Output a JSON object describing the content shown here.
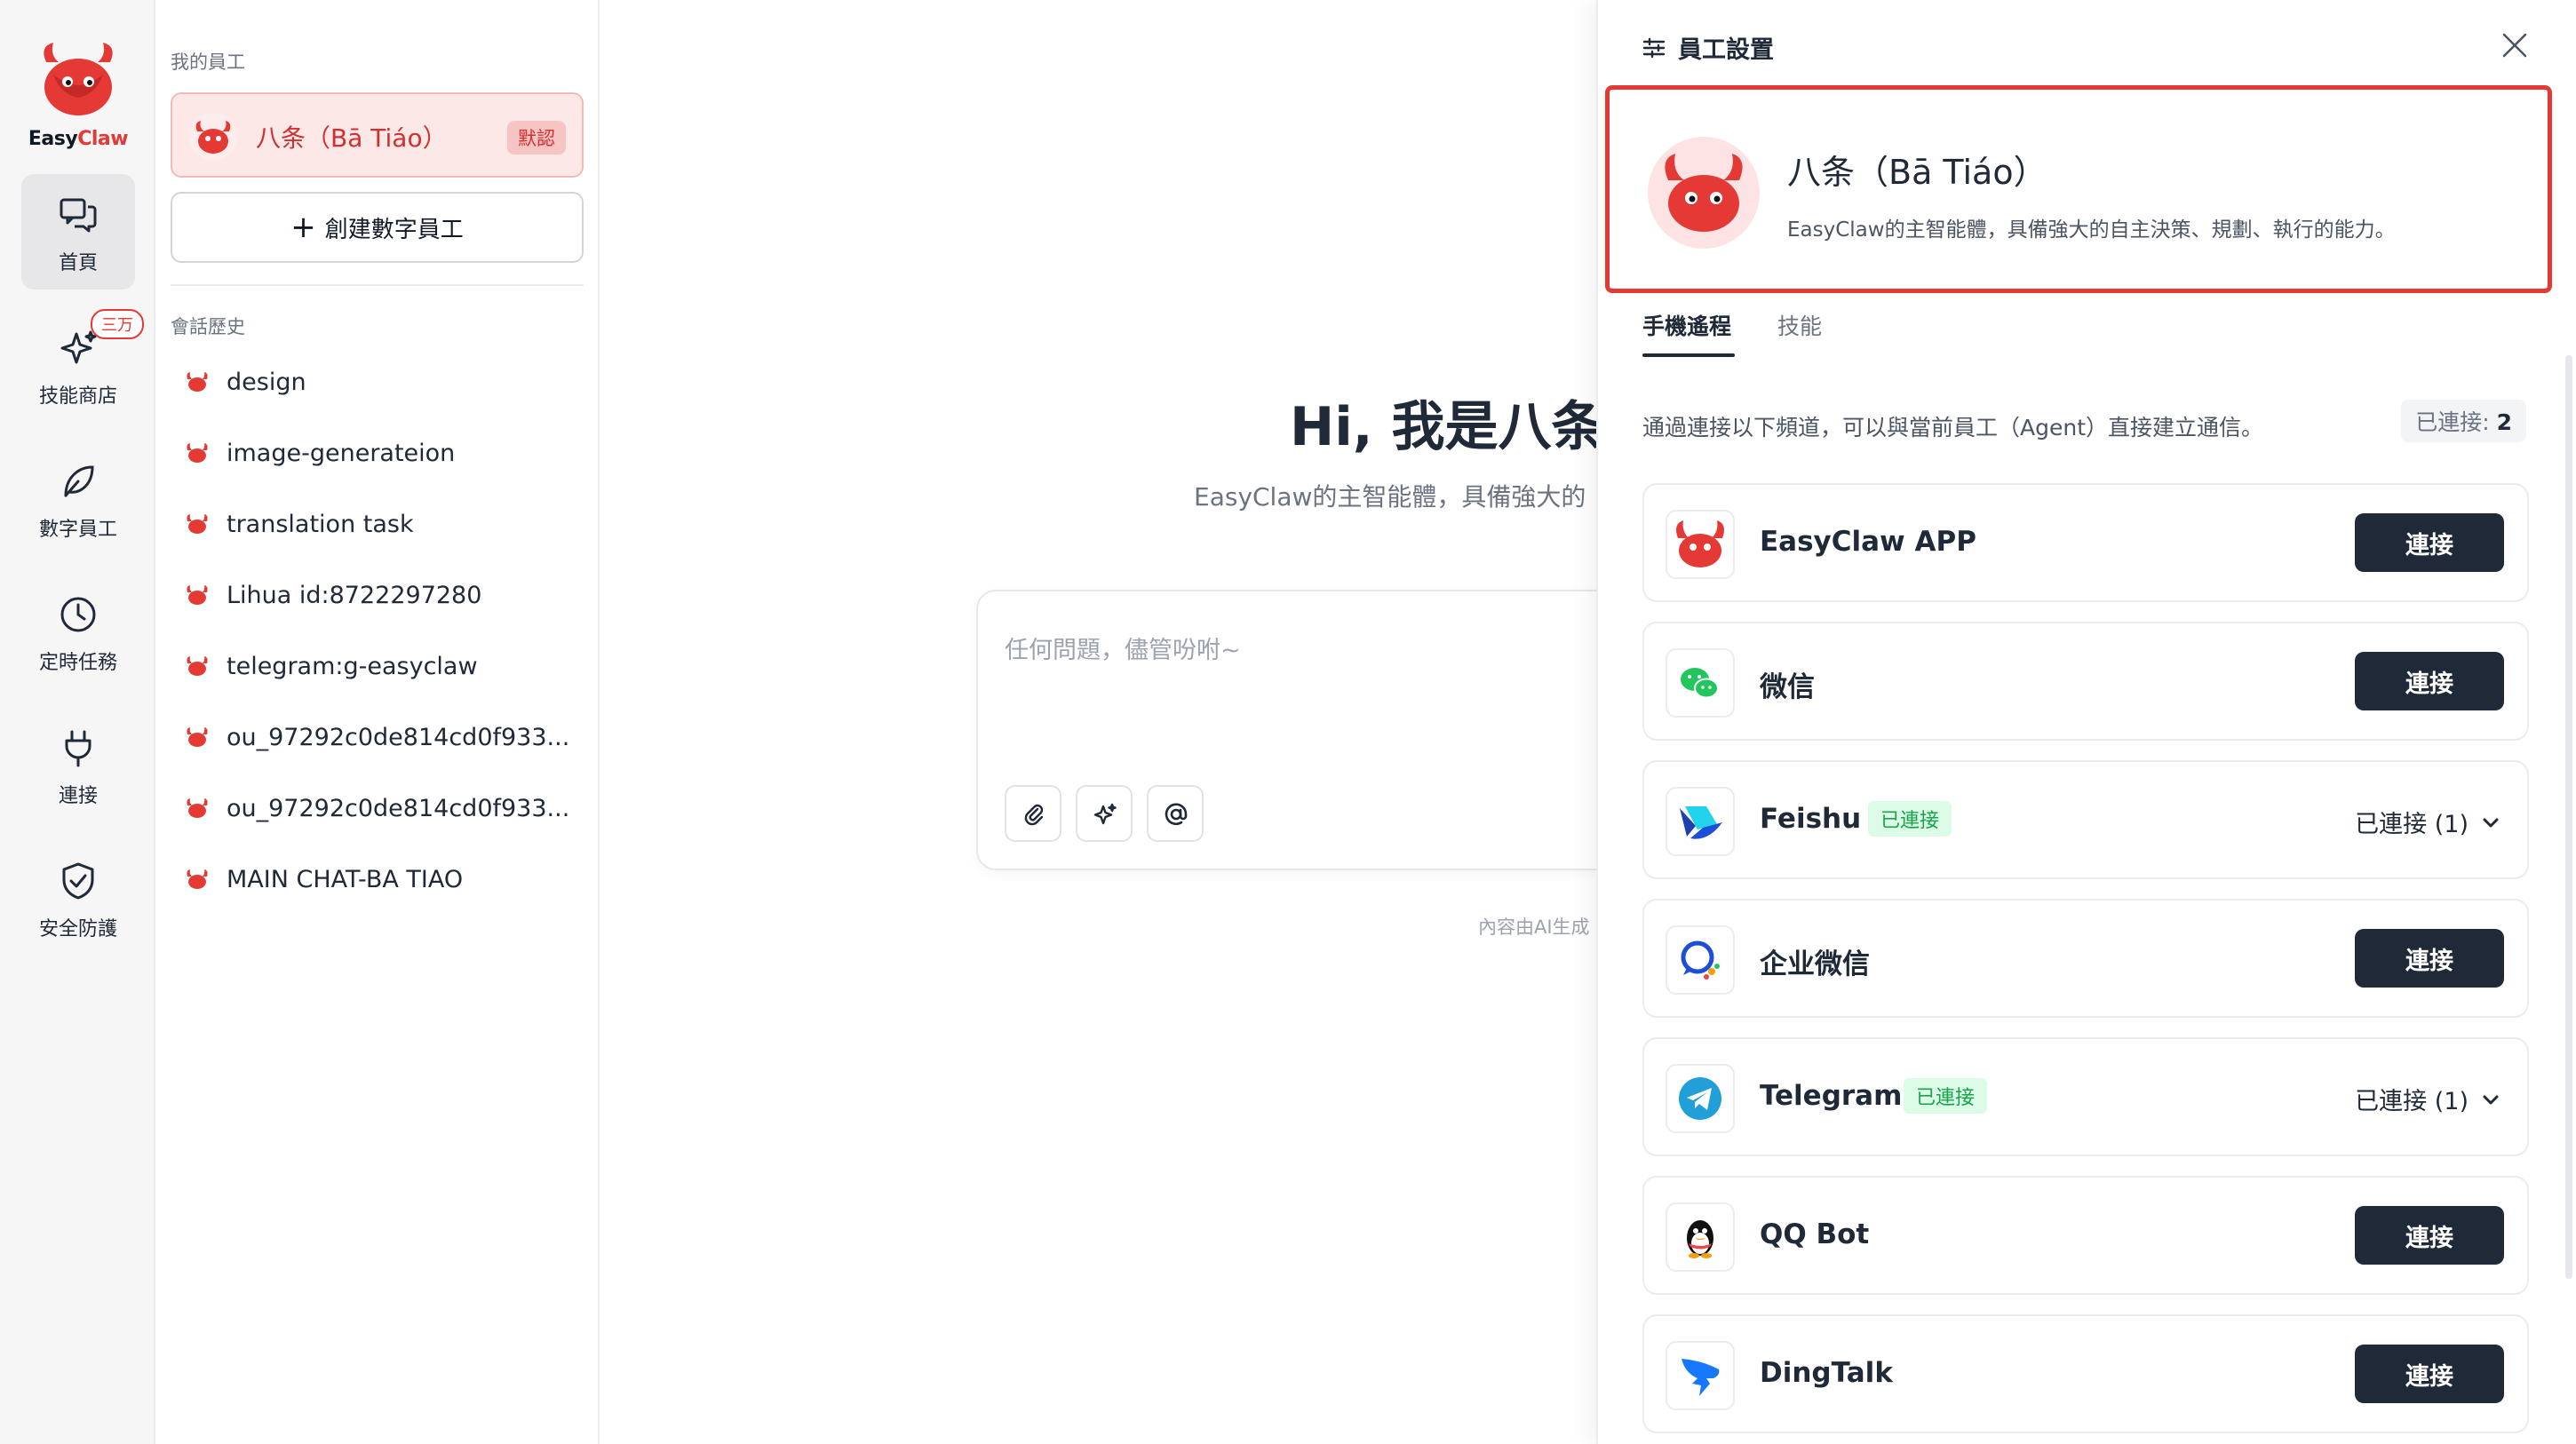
{
  "brand": {
    "logo_text_a": "Easy",
    "logo_text_b": "Claw"
  },
  "nav": {
    "items": [
      {
        "label": "首頁",
        "icon": "chat-bubbles-icon"
      },
      {
        "label": "技能商店",
        "icon": "sparkle-icon",
        "badge": "三万"
      },
      {
        "label": "數字員工",
        "icon": "leaf-icon"
      },
      {
        "label": "定時任務",
        "icon": "clock-icon"
      },
      {
        "label": "連接",
        "icon": "plug-icon"
      },
      {
        "label": "安全防護",
        "icon": "shield-icon"
      }
    ]
  },
  "sidebar": {
    "my_employees_label": "我的員工",
    "employee": {
      "name": "八条（Bā Tiáo）",
      "tag": "默認"
    },
    "create_label": "創建數字員工",
    "history_label": "會話歷史",
    "history": [
      "design",
      "image-generateion",
      "translation task",
      "Lihua id:8722297280",
      "telegram:g-easyclaw",
      "ou_97292c0de814cd0f933...",
      "ou_97292c0de814cd0f933...",
      "MAIN CHAT-BA TIAO"
    ]
  },
  "chat": {
    "greeting": "Hi, 我是八条",
    "subtitle": "EasyClaw的主智能體，具備強大的",
    "placeholder": "任何問題，儘管吩咐~",
    "disclaimer": "內容由AI生成"
  },
  "panel": {
    "title": "員工設置",
    "profile": {
      "name": "八条（Bā Tiáo）",
      "description": "EasyClaw的主智能體，具備強大的自主決策、規劃、執行的能力。"
    },
    "tabs": [
      "手機遙程",
      "技能"
    ],
    "intro": "通過連接以下頻道，可以與當前員工（Agent）直接建立通信。",
    "connected_label": "已連接:",
    "connected_count": "2",
    "channels": [
      {
        "name": "EasyClaw APP",
        "icon": "easyclaw-logo-icon",
        "connected": false,
        "button": "連接"
      },
      {
        "name": "微信",
        "icon": "wechat-icon",
        "connected": false,
        "button": "連接"
      },
      {
        "name": "Feishu",
        "icon": "feishu-icon",
        "connected": true,
        "tag": "已連接",
        "state": "已連接 (1)"
      },
      {
        "name": "企业微信",
        "icon": "wecom-icon",
        "connected": false,
        "button": "連接"
      },
      {
        "name": "Telegram",
        "icon": "telegram-icon",
        "connected": true,
        "tag": "已連接",
        "state": "已連接 (1)"
      },
      {
        "name": "QQ Bot",
        "icon": "qq-penguin-icon",
        "connected": false,
        "button": "連接"
      },
      {
        "name": "DingTalk",
        "icon": "dingtalk-icon",
        "connected": false,
        "button": "連接"
      }
    ]
  },
  "colors": {
    "accent": "#e53935",
    "dark_button": "#1f2937",
    "connected_tag": "#16a34a"
  }
}
